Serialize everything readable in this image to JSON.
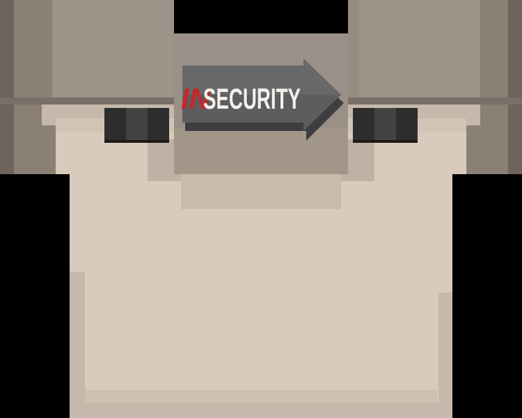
{
  "title": {
    "prefix": "IN",
    "main": "SECURITY"
  },
  "colors": {
    "floor": "#d9cbbc",
    "wall_dark": "#7d7066",
    "wall_mid": "#948a80",
    "wall_light": "#a59a8f",
    "void": "#000000",
    "sign": "#5d5d5f",
    "accent_red": "#c8262b",
    "title_white": "#f4f1ec"
  }
}
